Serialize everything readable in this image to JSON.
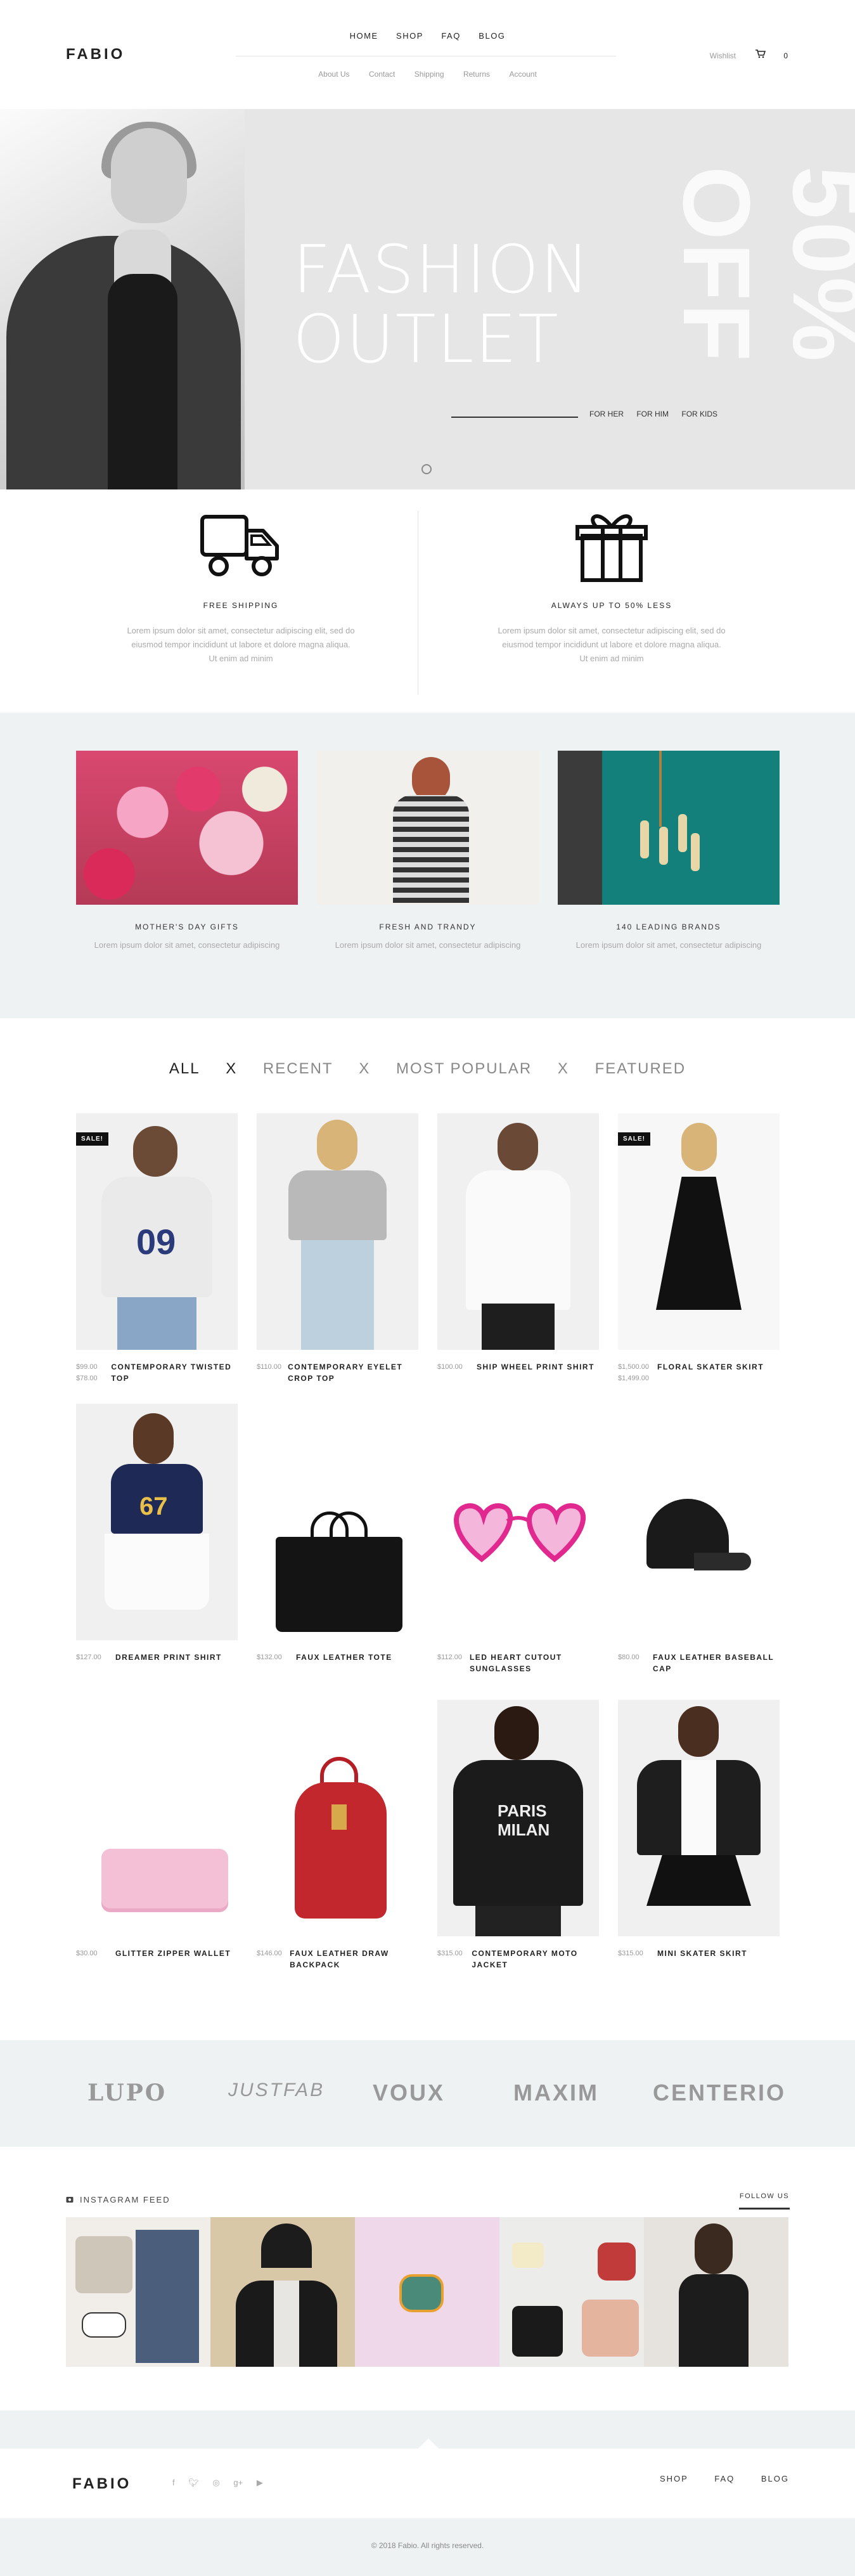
{
  "header": {
    "logo": "FABIO",
    "nav": [
      "HOME",
      "SHOP",
      "FAQ",
      "BLOG"
    ],
    "subnav": [
      "About Us",
      "Contact",
      "Shipping",
      "Returns",
      "Account"
    ],
    "wishlist": "Wishlist",
    "cart_count": "0"
  },
  "hero": {
    "title_line1": "FASHION",
    "title_line2": "OUTLET",
    "side_text": "50% OFF",
    "links": [
      "FOR HER",
      "FOR HIM",
      "FOR KIDS"
    ]
  },
  "features": [
    {
      "icon": "truck-icon",
      "title": "FREE SHIPPING",
      "text": "Lorem ipsum dolor sit amet, consectetur adipiscing elit, sed do eiusmod tempor incididunt ut labore et dolore magna aliqua. Ut enim ad minim"
    },
    {
      "icon": "gift-icon",
      "title": "ALWAYS UP TO 50% LESS",
      "text": "Lorem ipsum dolor sit amet, consectetur adipiscing elit, sed do eiusmod tempor incididunt ut labore et dolore magna aliqua. Ut enim ad minim"
    }
  ],
  "categories": [
    {
      "title": "MOTHER'S DAY GIFTS",
      "text": "Lorem ipsum dolor sit amet, consectetur adipiscing"
    },
    {
      "title": "FRESH AND TRANDY",
      "text": "Lorem ipsum dolor sit amet, consectetur adipiscing"
    },
    {
      "title": "140 LEADING BRANDS",
      "text": "Lorem ipsum dolor sit amet, consectetur adipiscing"
    }
  ],
  "filters": [
    "ALL",
    "X",
    "RECENT",
    "X",
    "MOST POPULAR",
    "X",
    "FEATURED"
  ],
  "sale_label": "SALE!",
  "products": [
    {
      "name": "CONTEMPORARY TWISTED TOP",
      "price": "$99.00",
      "old_price": "$78.00",
      "sale": true
    },
    {
      "name": "CONTEMPORARY EYELET CROP TOP",
      "price": "$110.00",
      "old_price": "",
      "sale": false
    },
    {
      "name": "SHIP WHEEL PRINT SHIRT",
      "price": "$100.00",
      "old_price": "",
      "sale": false
    },
    {
      "name": "FLORAL SKATER SKIRT",
      "price": "$1,500.00",
      "old_price": "$1,499.00",
      "sale": true
    },
    {
      "name": "DREAMER PRINT SHIRT",
      "price": "$127.00",
      "old_price": "",
      "sale": false
    },
    {
      "name": "FAUX LEATHER TOTE",
      "price": "$132.00",
      "old_price": "",
      "sale": false
    },
    {
      "name": "LED HEART CUTOUT SUNGLASSES",
      "price": "$112.00",
      "old_price": "",
      "sale": false
    },
    {
      "name": "FAUX LEATHER BASEBALL CAP",
      "price": "$80.00",
      "old_price": "",
      "sale": false
    },
    {
      "name": "GLITTER ZIPPER WALLET",
      "price": "$30.00",
      "old_price": "",
      "sale": false
    },
    {
      "name": "FAUX LEATHER DRAW BACKPACK",
      "price": "$146.00",
      "old_price": "",
      "sale": false
    },
    {
      "name": "CONTEMPORARY MOTO JACKET",
      "price": "$315.00",
      "old_price": "",
      "sale": false
    },
    {
      "name": "MINI SKATER SKIRT",
      "price": "$315.00",
      "old_price": "",
      "sale": false
    }
  ],
  "brands": [
    "LUPO",
    "JUSTFAB",
    "VOUX",
    "MAXIM",
    "CENTERIO"
  ],
  "instagram": {
    "title": "INSTAGRAM FEED",
    "follow": "FOLLOW US"
  },
  "footer": {
    "logo": "FABIO",
    "social_icons": [
      "facebook-icon",
      "twitter-icon",
      "instagram-icon",
      "google-plus-icon",
      "youtube-icon"
    ],
    "links": [
      "SHOP",
      "FAQ",
      "BLOG"
    ],
    "copyright": "© 2018 Fabio. All rights reserved."
  },
  "colors": {
    "light_bg": "#eef2f3",
    "accent": "#222222"
  }
}
